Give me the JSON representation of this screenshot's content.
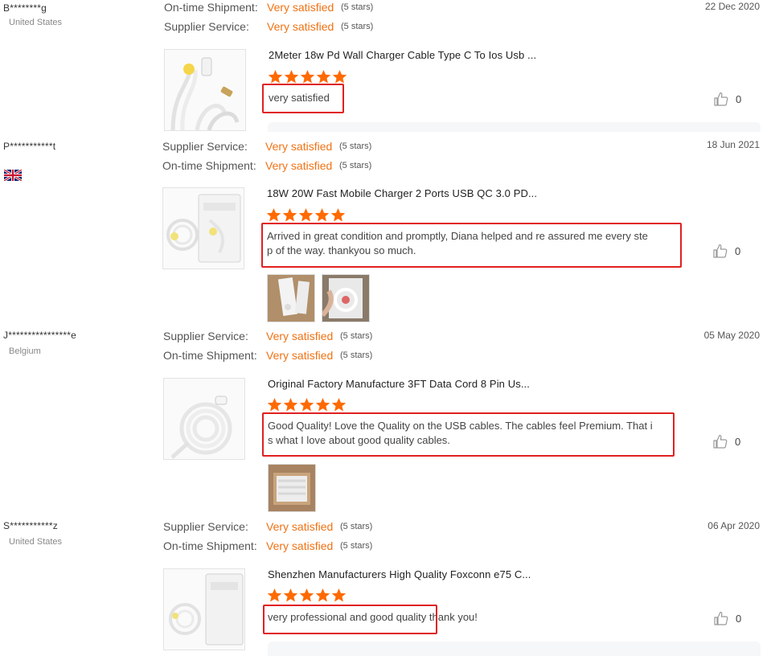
{
  "reviews": [
    {
      "buyer": "B********g",
      "country": "United States",
      "date": "22 Dec 2020",
      "ratings": [
        {
          "label": "On-time Shipment:",
          "value": "Very satisfied",
          "stars": "(5 stars)"
        },
        {
          "label": "Supplier Service:",
          "value": "Very satisfied",
          "stars": "(5 stars)"
        }
      ],
      "product_title": "2Meter 18w Pd Wall Charger Cable Type C To Ios Usb ...",
      "text": "very satisfied",
      "likes": "0"
    },
    {
      "buyer": "P***********t",
      "country_flag": "uk-flag-icon",
      "date": "18 Jun 2021",
      "ratings": [
        {
          "label": "Supplier Service:",
          "value": "Very satisfied",
          "stars": "(5 stars)"
        },
        {
          "label": "On-time Shipment:",
          "value": "Very satisfied",
          "stars": "(5 stars)"
        }
      ],
      "product_title": "18W 20W Fast Mobile Charger 2 Ports USB QC 3.0 PD...",
      "text_line1": "Arrived in great condition and promptly, Diana helped and re assured me every ste",
      "text_line2": "p of the way. thankyou so much.",
      "likes": "0"
    },
    {
      "buyer": "J****************e",
      "country": "Belgium",
      "date": "05 May 2020",
      "ratings": [
        {
          "label": "Supplier Service:",
          "value": "Very satisfied",
          "stars": "(5 stars)"
        },
        {
          "label": "On-time Shipment:",
          "value": "Very satisfied",
          "stars": "(5 stars)"
        }
      ],
      "product_title": "Original Factory Manufacture 3FT Data Cord 8 Pin Us...",
      "text_line1": "Good Quality! Love the Quality on the USB cables. The cables feel Premium. That i",
      "text_line2": "s what I love about good quality cables.",
      "likes": "0"
    },
    {
      "buyer": "S***********z",
      "country": "United States",
      "date": "06 Apr 2020",
      "ratings": [
        {
          "label": "Supplier Service:",
          "value": "Very satisfied",
          "stars": "(5 stars)"
        },
        {
          "label": "On-time Shipment:",
          "value": "Very satisfied",
          "stars": "(5 stars)"
        }
      ],
      "product_title": "Shenzhen Manufacturers High Quality Foxconn e75 C...",
      "text": "very professional and good quality thank you!",
      "likes": "0"
    }
  ],
  "colors": {
    "accent_orange": "#f07214",
    "star_orange": "#ff6a00",
    "highlight_red": "#e02020"
  },
  "icons": {
    "star": "star-icon",
    "like": "thumbs-up-icon"
  }
}
